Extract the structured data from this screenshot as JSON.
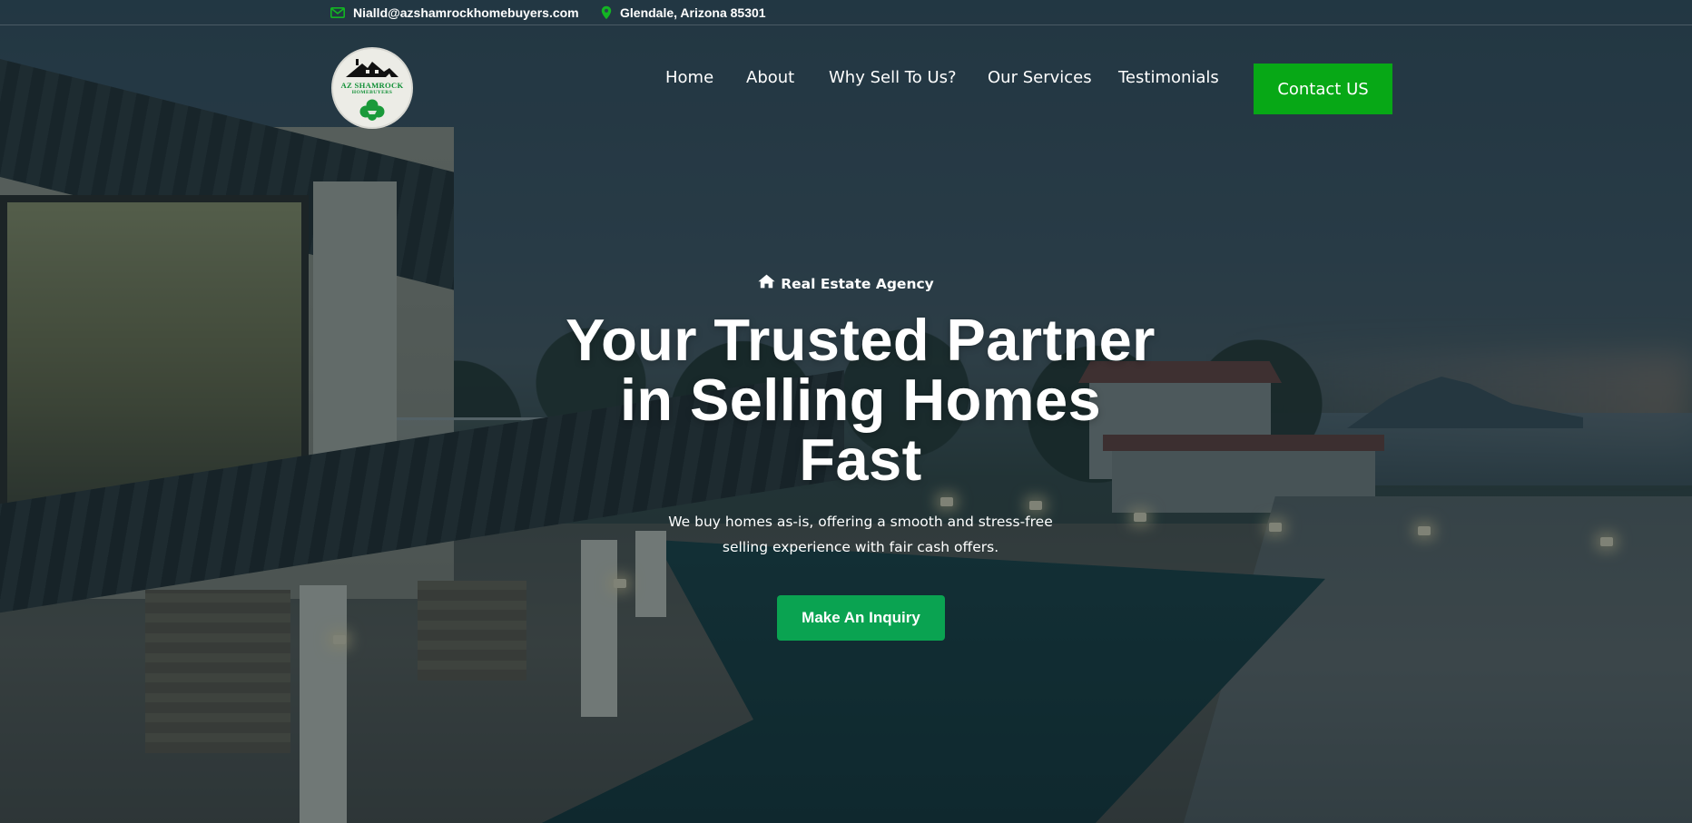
{
  "topbar": {
    "email": "Nialld@azshamrockhomebuyers.com",
    "email_icon": "envelope-icon",
    "location": "Glendale, Arizona 85301",
    "location_icon": "map-pin-icon"
  },
  "logo": {
    "name": "AZ SHAMROCK",
    "sub": "HOMEBUYERS",
    "icon": "shamrock-house-logo"
  },
  "nav": {
    "items": [
      {
        "label": "Home"
      },
      {
        "label": "About"
      },
      {
        "label": "Why Sell To Us?"
      },
      {
        "label": "Our Services"
      },
      {
        "label": "Testimonials"
      }
    ],
    "contact_label": "Contact US"
  },
  "hero": {
    "eyebrow_icon": "home-icon",
    "eyebrow": "Real Estate Agency",
    "headline_lines": [
      "Your Trusted Partner",
      "in Selling Homes",
      "Fast"
    ],
    "subtext": "We buy homes as-is, offering a smooth and stress-free selling experience with fair cash offers.",
    "cta_label": "Make An Inquiry"
  },
  "colors": {
    "accent_green": "#07a816",
    "cta_green": "#0aa351",
    "icon_green": "#13b523",
    "overlay": "#14262e"
  }
}
